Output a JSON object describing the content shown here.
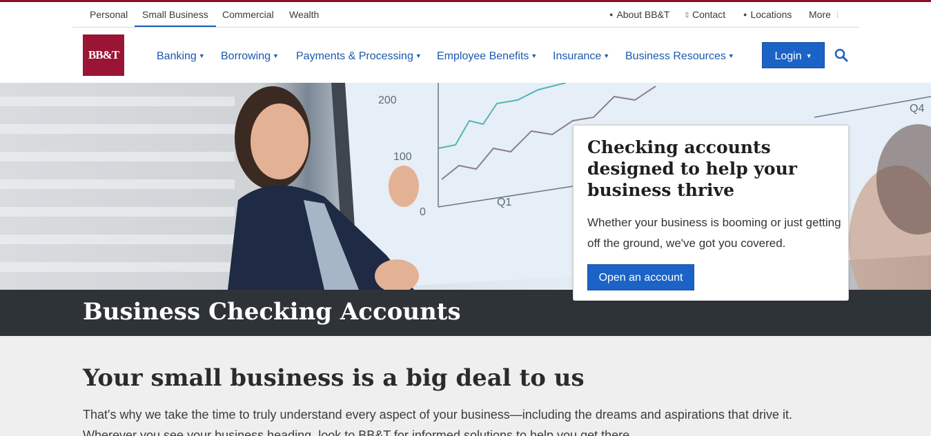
{
  "brand": {
    "logo_text": "BB&T",
    "color": "#9a1436",
    "accent": "#1b63c6"
  },
  "segments": [
    {
      "label": "Personal"
    },
    {
      "label": "Small Business",
      "active": true
    },
    {
      "label": "Commercial"
    },
    {
      "label": "Wealth"
    }
  ],
  "utility": {
    "about": "About BB&T",
    "contact": "Contact",
    "locations": "Locations",
    "more": "More"
  },
  "nav": {
    "banking": "Banking",
    "borrowing": "Borrowing",
    "payments": "Payments & Processing",
    "employee": "Employee Benefits",
    "insurance": "Insurance",
    "resources": "Business Resources"
  },
  "login_label": "Login",
  "hero": {
    "chart_labels": {
      "y200": "200",
      "y100": "100",
      "y0": "0",
      "q1": "Q1",
      "q4": "Q4"
    }
  },
  "card": {
    "heading": "Checking accounts designed to help your business thrive",
    "body": "Whether your business is booming or just getting off the ground, we've got you covered.",
    "button": "Open an account"
  },
  "page_title": "Business Checking Accounts",
  "section": {
    "heading": "Your small business is a big deal to us",
    "text": "That's why we take the time to truly understand every aspect of your business—including the dreams and aspirations that drive it. Wherever you see your business heading, look to BB&T for informed solutions to help you get there."
  }
}
